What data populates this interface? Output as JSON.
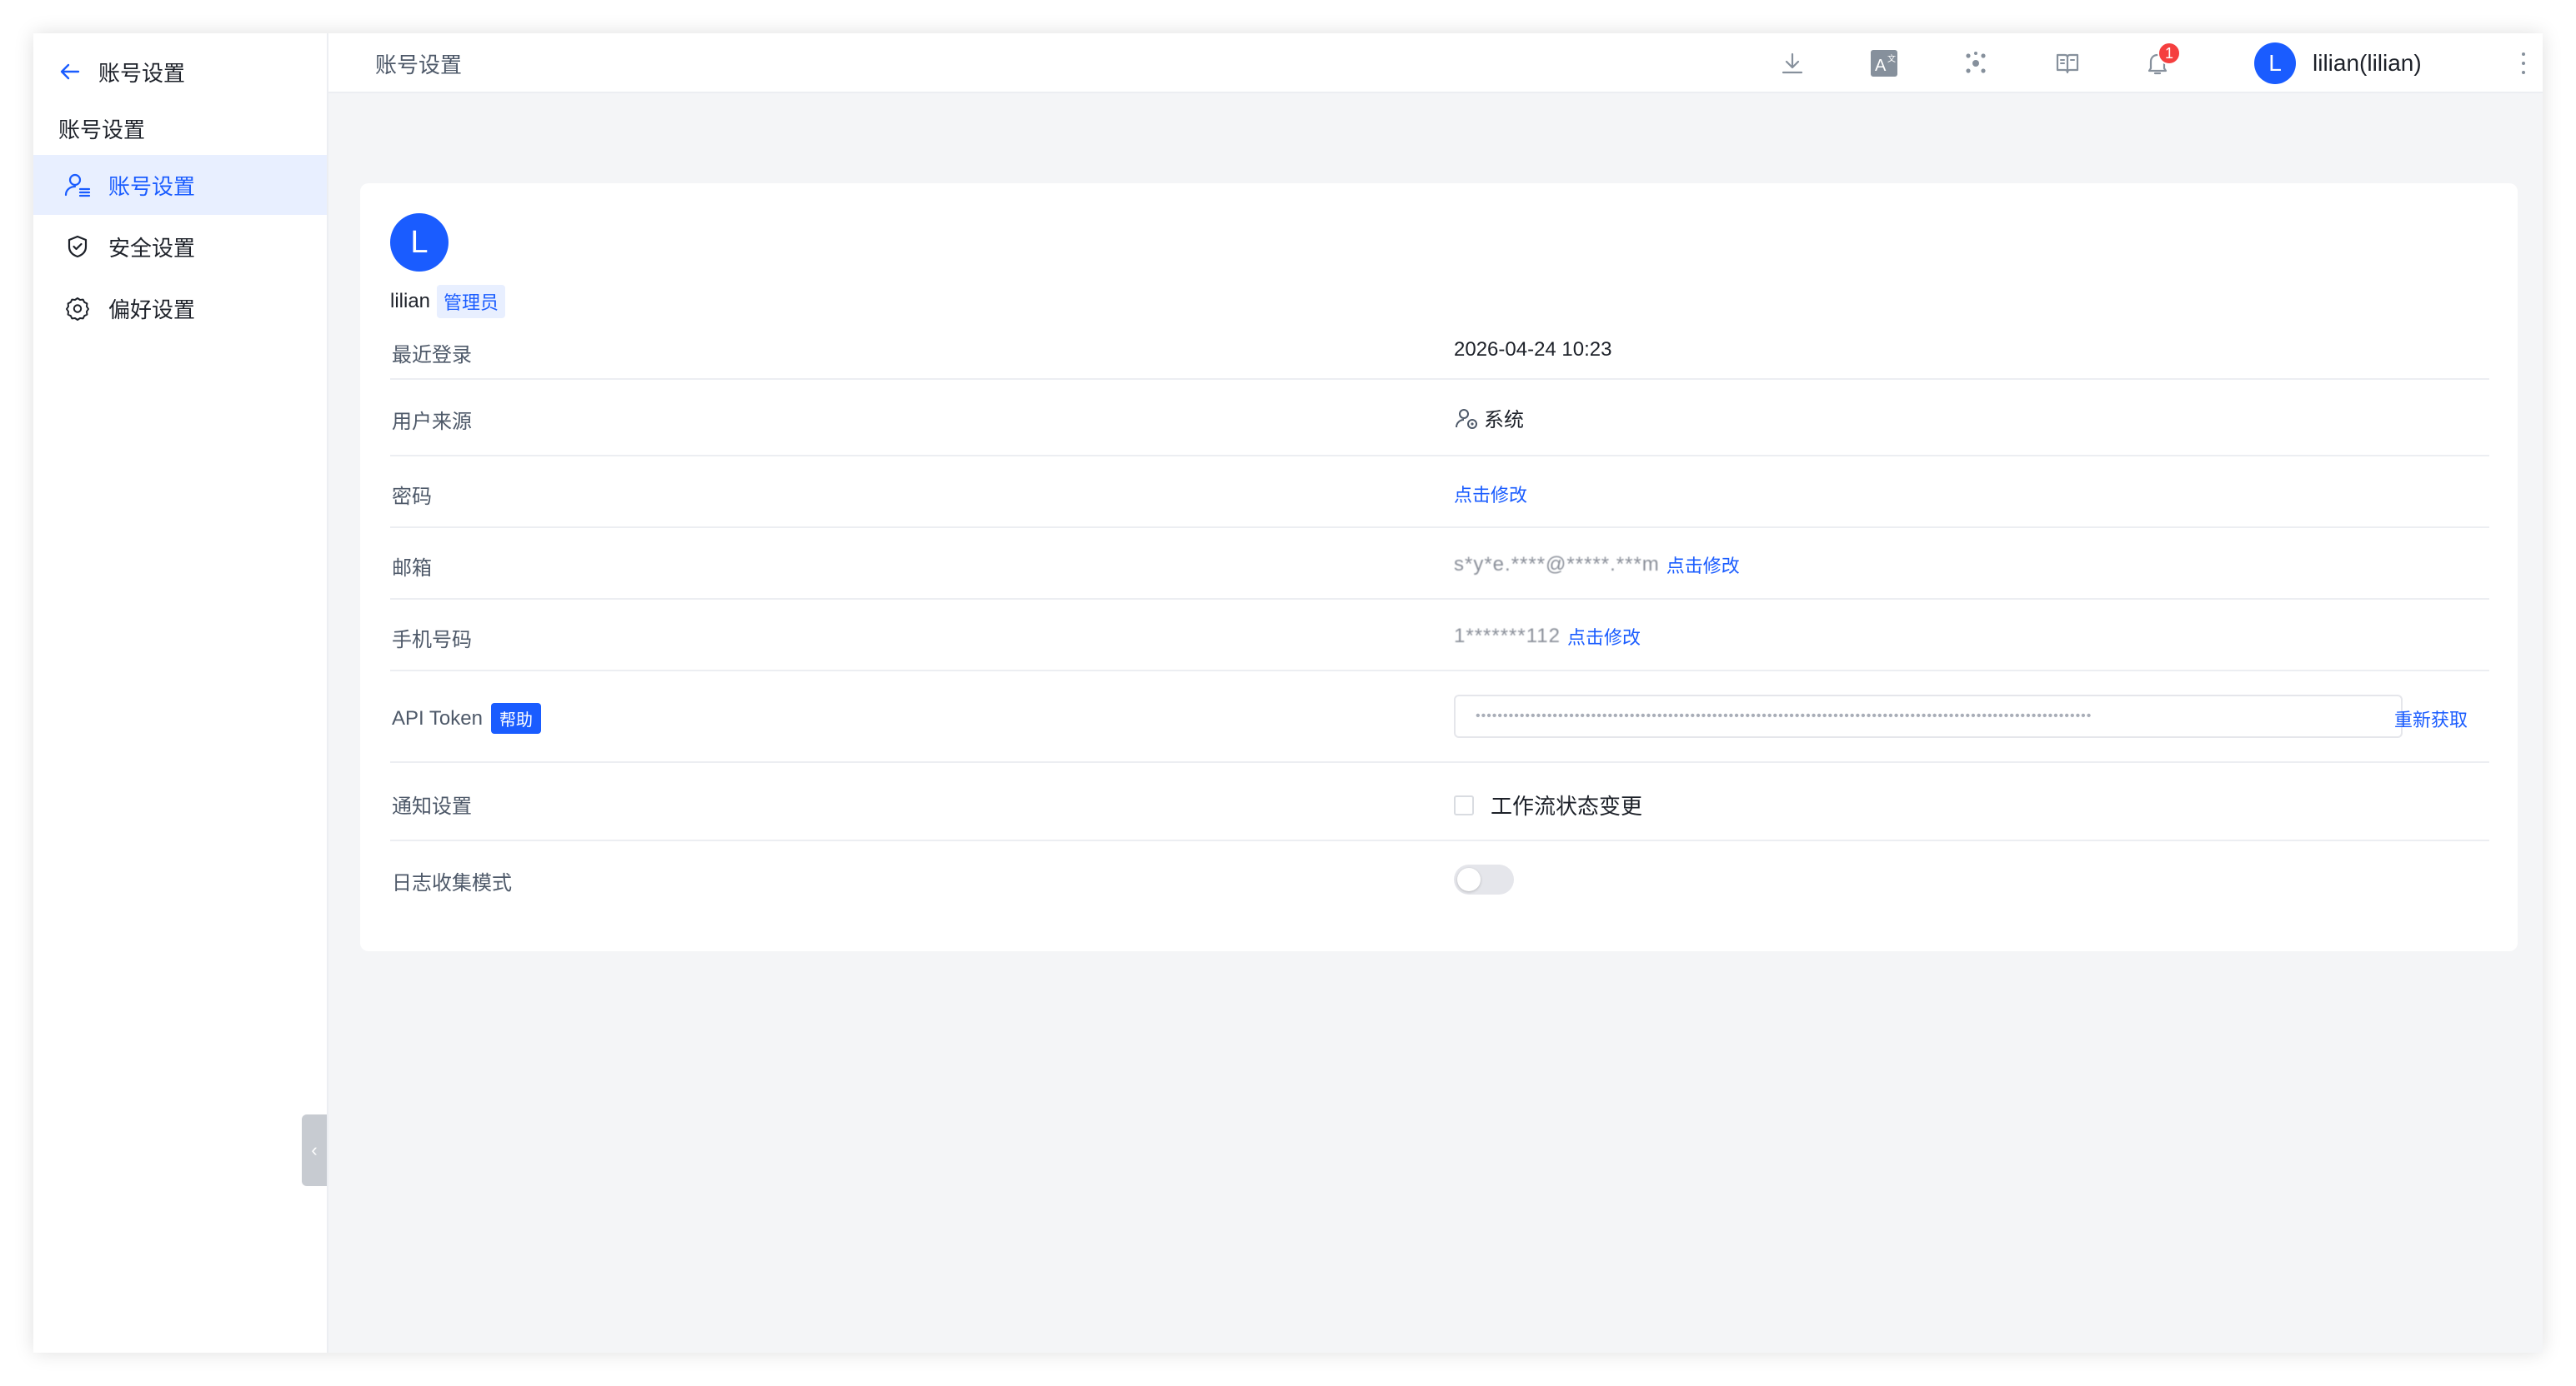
{
  "sidebar": {
    "title": "账号设置",
    "section": "账号设置",
    "items": [
      {
        "label": "账号设置",
        "icon": "user-settings-icon",
        "active": true
      },
      {
        "label": "安全设置",
        "icon": "shield-icon",
        "active": false
      },
      {
        "label": "偏好设置",
        "icon": "gear-icon",
        "active": false
      }
    ]
  },
  "topbar": {
    "breadcrumb": "账号设置",
    "icons": [
      "download-icon",
      "translate-icon",
      "apps-icon",
      "docs-icon",
      "bell-icon"
    ],
    "notification_count": "1",
    "user_initial": "L",
    "user_display": "lilian(lilian)"
  },
  "profile": {
    "initial": "L",
    "username": "lilian",
    "role": "管理员",
    "rows": {
      "last_login": {
        "label": "最近登录",
        "value": "2026-04-24 10:23"
      },
      "user_source": {
        "label": "用户来源",
        "value": "系统"
      },
      "password": {
        "label": "密码",
        "action": "点击修改"
      },
      "email": {
        "label": "邮箱",
        "masked": "s*y*e.****@*****.***m",
        "action": "点击修改"
      },
      "phone": {
        "label": "手机号码",
        "masked": "1*******112",
        "action": "点击修改"
      },
      "api_token": {
        "label": "API Token",
        "help": "帮助",
        "value": "••••••••••••••••••••••••••••••••••••••••••••••••••••••••••••••••••••••••••••••••••••••••••••••••••••••••••••••••",
        "action": "重新获取"
      },
      "notify": {
        "label": "通知设置",
        "option": "工作流状态变更",
        "checked": false
      },
      "log_mode": {
        "label": "日志收集模式",
        "enabled": false
      }
    }
  },
  "colors": {
    "accent": "#1a5cff",
    "badge": "#f53f3f",
    "background": "#f4f5f7"
  }
}
